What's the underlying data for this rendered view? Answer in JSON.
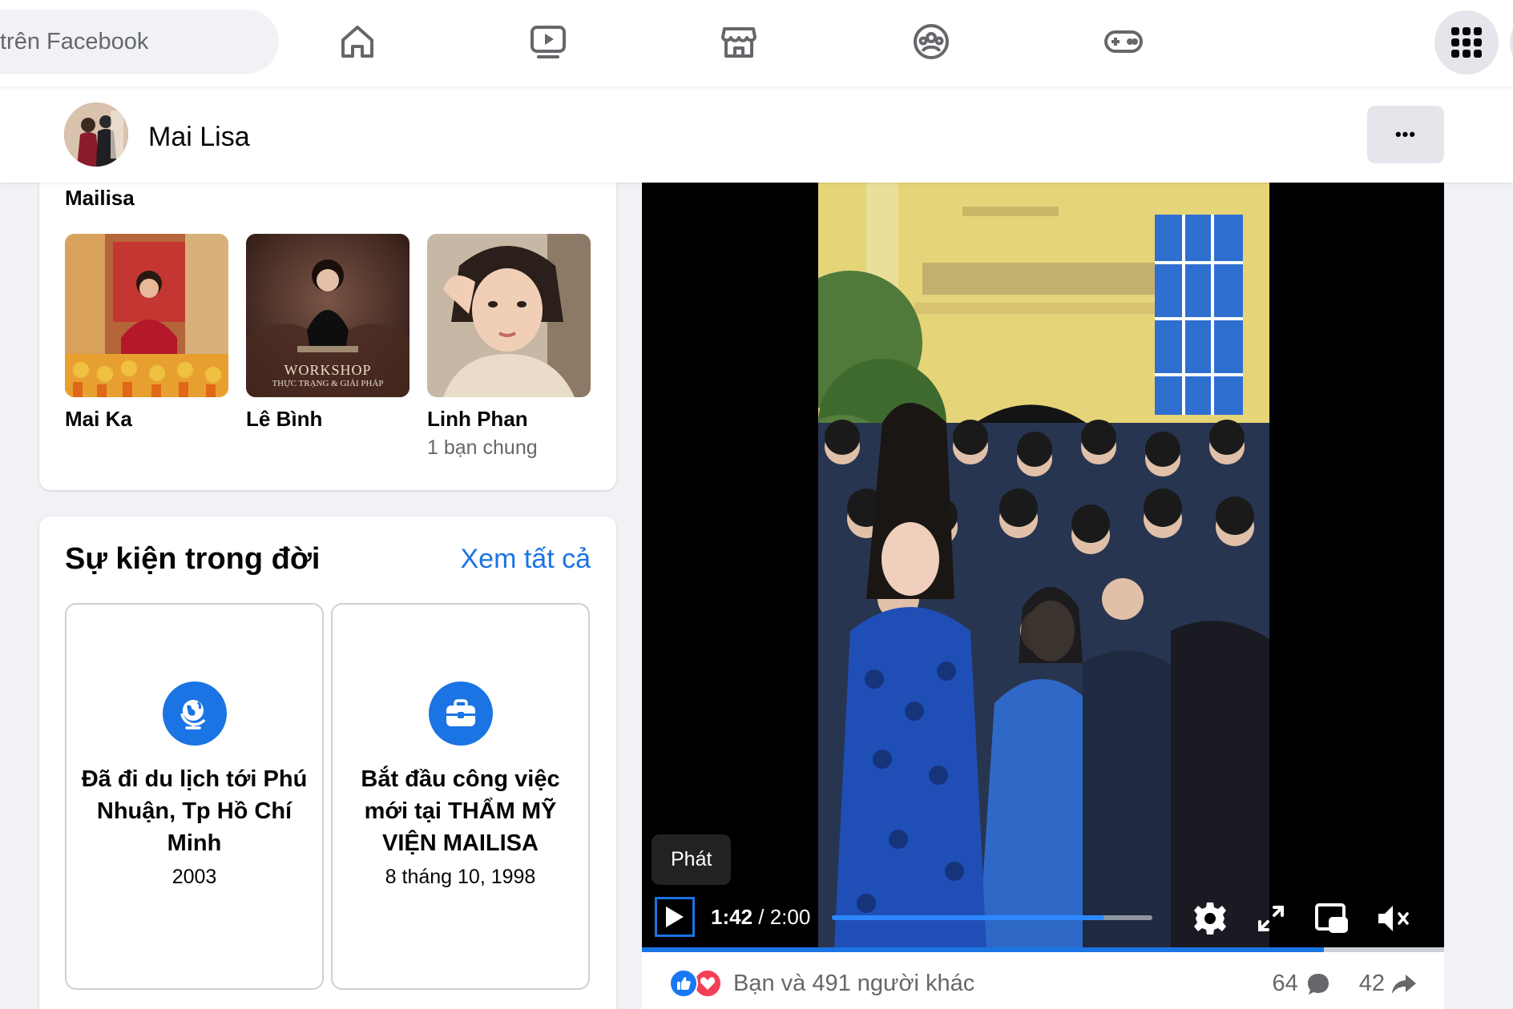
{
  "topnav": {
    "search_text": "trên Facebook",
    "icons": [
      "home-icon",
      "video-icon",
      "marketplace-icon",
      "groups-icon",
      "gaming-icon",
      "menu-grid-icon"
    ]
  },
  "profile": {
    "name": "Mai Lisa",
    "more_label": "•••"
  },
  "friends": {
    "cut_text": "Mailisa",
    "items": [
      {
        "name": "Mai Ka",
        "sub": ""
      },
      {
        "name": "Lê Bình",
        "sub": ""
      },
      {
        "name": "Linh Phan",
        "sub": "1 bạn chung"
      }
    ],
    "workshop_text": "WORKSHOP",
    "workshop_sub": "THỰC TRẠNG & GIẢI PHÁP"
  },
  "events": {
    "title": "Sự kiện trong đời",
    "see_all": "Xem tất cả",
    "items": [
      {
        "title": "Đã đi du lịch tới Phú Nhuận, Tp Hồ Chí Minh",
        "date": "2003",
        "icon": "globe-icon"
      },
      {
        "title": "Bắt đầu công việc mới tại THẨM MỸ VIỆN MAILISA",
        "date": "8 tháng 10, 1998",
        "icon": "briefcase-icon"
      }
    ]
  },
  "video": {
    "tooltip": "Phát",
    "current_time": "1:42",
    "separator": " / ",
    "duration": "2:00",
    "progress": 0.85,
    "buffered": 0.0
  },
  "post": {
    "reaction_text": "Bạn và 491 người khác",
    "comments": "64",
    "shares": "42"
  },
  "colors": {
    "accent": "#1b74e4",
    "like": "#1877f2",
    "love": "#f33e58"
  }
}
